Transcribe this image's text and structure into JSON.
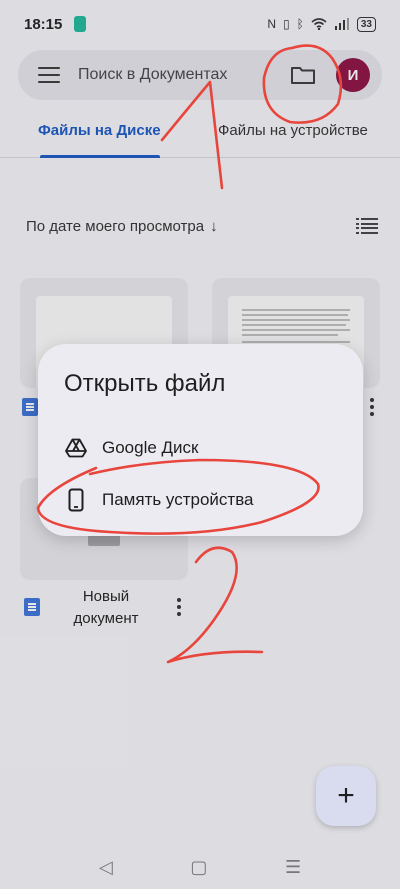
{
  "status_bar": {
    "time": "18:15",
    "right_icons": [
      "nfc-icon",
      "vibrate-icon",
      "bluetooth-icon",
      "wifi-icon",
      "signal-icon"
    ],
    "battery": "33"
  },
  "search": {
    "placeholder": "Поиск в Документах",
    "avatar_letter": "И",
    "avatar_color": "#8c1043"
  },
  "tabs": [
    {
      "label": "Файлы на Диске",
      "active": true
    },
    {
      "label": "Файлы на устройстве",
      "active": false
    }
  ],
  "sort": {
    "label": "По дате моего просмотра",
    "arrow": "↓"
  },
  "files": [
    {
      "name": ""
    },
    {
      "name": ""
    },
    {
      "name": "Новый документ",
      "line1": "Новый",
      "line2": "документ"
    }
  ],
  "dialog": {
    "title": "Открыть файл",
    "options": [
      {
        "label": "Google Диск",
        "icon": "google-drive-icon"
      },
      {
        "label": "Память устройства",
        "icon": "phone-icon"
      }
    ]
  },
  "fab": {
    "label": "+"
  },
  "nav": {
    "back": "◁",
    "home": "▢",
    "menu": "☰"
  },
  "annotation_color": "#e8453c",
  "accent_color": "#1b59c4"
}
